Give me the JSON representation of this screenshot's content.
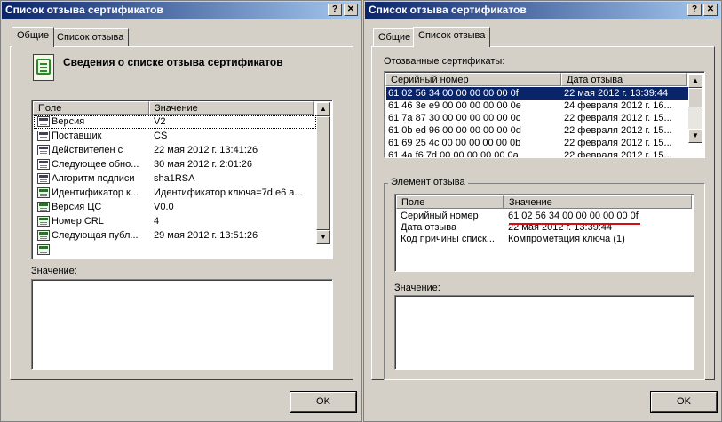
{
  "left_window": {
    "title": "Список отзыва сертификатов",
    "help_button": "?",
    "close_button": "✕",
    "tabs": [
      {
        "label": "Общие",
        "active": true
      },
      {
        "label": "Список отзыва",
        "active": false
      }
    ],
    "header_title": "Сведения о списке отзыва сертификатов",
    "table": {
      "columns": [
        "Поле",
        "Значение"
      ],
      "rows": [
        {
          "field": "Версия",
          "value": "V2",
          "icon": "field-icon",
          "focused": true
        },
        {
          "field": "Поставщик",
          "value": "CS",
          "icon": "field-icon"
        },
        {
          "field": "Действителен с",
          "value": "22 мая 2012 г. 13:41:26",
          "icon": "field-icon"
        },
        {
          "field": "Следующее обно...",
          "value": "30 мая 2012 г. 2:01:26",
          "icon": "field-icon"
        },
        {
          "field": "Алгоритм подписи",
          "value": "sha1RSA",
          "icon": "field-icon"
        },
        {
          "field": "Идентификатор к...",
          "value": "Идентификатор ключа=7d e6 a...",
          "icon": "extension-icon"
        },
        {
          "field": "Версия ЦС",
          "value": "V0.0",
          "icon": "extension-icon"
        },
        {
          "field": "Номер CRL",
          "value": "4",
          "icon": "extension-icon"
        },
        {
          "field": "Следующая публ...",
          "value": "29 мая 2012 г. 13:51:26",
          "icon": "extension-icon"
        },
        {
          "field": "",
          "value": "",
          "icon": "extension-icon"
        }
      ]
    },
    "value_label": "Значение:",
    "ok_button": "OK"
  },
  "right_window": {
    "title": "Список отзыва сертификатов",
    "help_button": "?",
    "close_button": "✕",
    "tabs": [
      {
        "label": "Общие",
        "active": false
      },
      {
        "label": "Список отзыва",
        "active": true
      }
    ],
    "revoked_label": "Отозванные сертификаты:",
    "revoked_table": {
      "columns": [
        "Серийный номер",
        "Дата отзыва"
      ],
      "rows": [
        {
          "serial": "61 02 56 34 00 00 00 00 00 0f",
          "date": "22 мая 2012 г. 13:39:44",
          "selected": true
        },
        {
          "serial": "61 46 3e e9 00 00 00 00 00 0e",
          "date": "24 февраля 2012 г. 16..."
        },
        {
          "serial": "61 7a 87 30 00 00 00 00 00 0c",
          "date": "22 февраля 2012 г. 15..."
        },
        {
          "serial": "61 0b ed 96 00 00 00 00 00 0d",
          "date": "22 февраля 2012 г. 15..."
        },
        {
          "serial": "61 69 25 4c 00 00 00 00 00 0b",
          "date": "22 февраля 2012 г. 15..."
        },
        {
          "serial": "61 4a f6 7d 00 00 00 00 00 0a",
          "date": "22 февраля 2012 г. 15..."
        }
      ]
    },
    "element_group_label": "Элемент отзыва",
    "element_table": {
      "columns": [
        "Поле",
        "Значение"
      ],
      "rows": [
        {
          "field": "Серийный номер",
          "value": "61 02 56 34 00 00 00 00 00 0f"
        },
        {
          "field": "Дата отзыва",
          "value": "22 мая 2012 г. 13:39:44"
        },
        {
          "field": "Код причины списк...",
          "value": "Компрометация ключа (1)"
        }
      ]
    },
    "value_label": "Значение:",
    "ok_button": "OK"
  },
  "colors": {
    "selection": "#0a246a",
    "annotation_underline": "#d01010"
  }
}
